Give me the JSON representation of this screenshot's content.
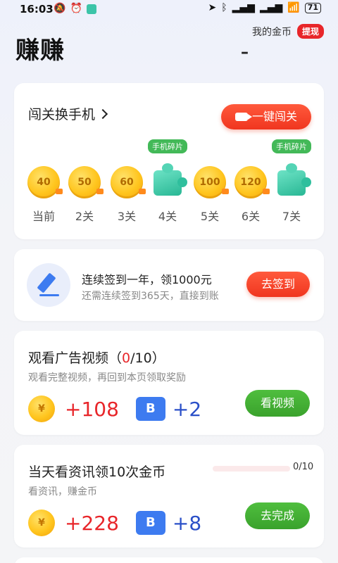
{
  "status_bar": {
    "time": "16:03",
    "battery": "71",
    "icons": [
      "mute-icon",
      "alarm-icon",
      "app-notification-icon",
      "location-icon",
      "bluetooth-icon",
      "signal-icon",
      "signal-icon",
      "wifi-icon",
      "battery-icon"
    ]
  },
  "header": {
    "title": "赚赚",
    "coins_label": "我的金币",
    "withdraw_label": "提现",
    "coins_value": "–"
  },
  "challenge": {
    "title": "闯关换手机",
    "button_label": "一键闯关",
    "piece_tag": "手机碎片",
    "levels": [
      {
        "type": "coin",
        "value": "40",
        "label": "当前"
      },
      {
        "type": "coin",
        "value": "50",
        "label": "2关"
      },
      {
        "type": "coin",
        "value": "60",
        "label": "3关"
      },
      {
        "type": "puzzle",
        "value": "",
        "label": "4关"
      },
      {
        "type": "coin",
        "value": "100",
        "label": "5关"
      },
      {
        "type": "coin",
        "value": "120",
        "label": "6关"
      },
      {
        "type": "puzzle",
        "value": "",
        "label": "7关"
      }
    ]
  },
  "signin": {
    "title": "连续签到一年，领1000元",
    "subtitle": "还需连续签到365天，直接到账",
    "button_label": "去签到"
  },
  "ad_task": {
    "title_prefix": "观看广告视频（",
    "progress_current": "0",
    "title_suffix": "/10）",
    "subtitle": "观看完整视频，再回到本页领取奖励",
    "coin_symbol": "¥",
    "coin_reward": "+108",
    "ticket_symbol": "B",
    "ticket_reward": "+2",
    "button_label": "看视频"
  },
  "news_task": {
    "title": "当天看资讯领10次金币",
    "subtitle": "看资讯，赚金币",
    "progress_text": "0/10",
    "progress_fraction": 0,
    "coin_symbol": "¥",
    "coin_reward": "+228",
    "ticket_symbol": "B",
    "ticket_reward": "+8",
    "button_label": "去完成"
  },
  "colors": {
    "accent_red": "#e8262a",
    "button_green": "#3aa22c",
    "ticket_blue": "#3d7bf0",
    "coin_gold": "#ffc51e"
  }
}
